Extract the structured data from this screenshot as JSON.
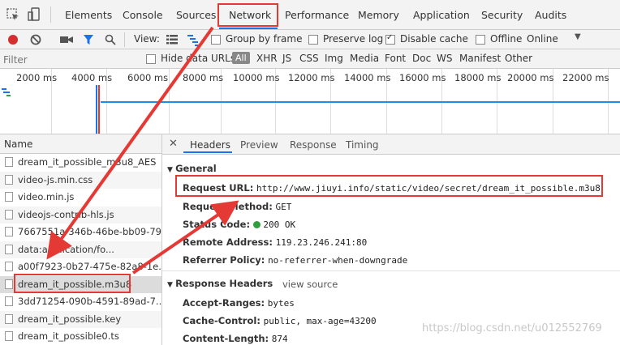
{
  "tabs": [
    "Elements",
    "Console",
    "Sources",
    "Network",
    "Performance",
    "Memory",
    "Application",
    "Security",
    "Audits"
  ],
  "toolbar": {
    "view_label": "View:",
    "group_by_frame": "Group by frame",
    "preserve_log": "Preserve log",
    "disable_cache": "Disable cache",
    "offline": "Offline",
    "throttle": "Online"
  },
  "filter": {
    "placeholder": "Filter",
    "hide_data_urls": "Hide data URLs",
    "types": [
      "All",
      "XHR",
      "JS",
      "CSS",
      "Img",
      "Media",
      "Font",
      "Doc",
      "WS",
      "Manifest",
      "Other"
    ]
  },
  "timeline": {
    "ticks": [
      "2000 ms",
      "4000 ms",
      "6000 ms",
      "8000 ms",
      "10000 ms",
      "12000 ms",
      "14000 ms",
      "16000 ms",
      "18000 ms",
      "20000 ms",
      "22000 ms"
    ]
  },
  "requests": {
    "header": "Name",
    "items": [
      "dream_it_possible_m3u8_AES",
      "video-js.min.css",
      "video.min.js",
      "videojs-contrib-hls.js",
      "7667551a-346b-46be-bb09-79...",
      "data:application/fo...",
      "a00f7923-0b27-475e-82a8-1e...",
      "dream_it_possible.m3u8",
      "3dd71254-090b-4591-89ad-7...",
      "dream_it_possible.key",
      "dream_it_possible0.ts"
    ]
  },
  "detail_tabs": [
    "Headers",
    "Preview",
    "Response",
    "Timing"
  ],
  "general": {
    "title": "General",
    "request_url_label": "Request URL:",
    "request_url": "http://www.jiuyi.info/static/video/secret/dream_it_possible.m3u8",
    "request_method_label": "Request Method:",
    "request_method": "GET",
    "status_code_label": "Status Code:",
    "status_code": "200 OK",
    "remote_address_label": "Remote Address:",
    "remote_address": "119.23.246.241:80",
    "referrer_policy_label": "Referrer Policy:",
    "referrer_policy": "no-referrer-when-downgrade"
  },
  "response_headers": {
    "title": "Response Headers",
    "view_source": "view source",
    "accept_ranges_label": "Accept-Ranges:",
    "accept_ranges": "bytes",
    "cache_control_label": "Cache-Control:",
    "cache_control": "public, max-age=43200",
    "content_length_label": "Content-Length:",
    "content_length": "874"
  },
  "watermark": "https://blog.csdn.net/u012552769",
  "colors": {
    "annotation_red": "#e53935",
    "record_red": "#d32f2f",
    "active_blue": "#1a73e8",
    "status_green": "#2e9e3e"
  }
}
